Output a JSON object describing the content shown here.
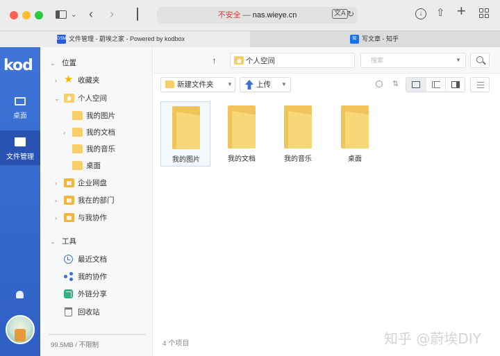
{
  "browser": {
    "address": {
      "security": "不安全",
      "separator": "—",
      "host": "nas.wieye.cn"
    },
    "tabs": [
      {
        "favicon": "DSM",
        "title": "文件管理 - 蔚埃之家 - Powered by kodbox"
      },
      {
        "favicon": "知",
        "title": "写文章 - 知乎"
      }
    ]
  },
  "rail": {
    "logo": "kod",
    "items": [
      {
        "label": "桌面",
        "icon": "monitor-icon"
      },
      {
        "label": "文件管理",
        "icon": "folder-icon"
      }
    ]
  },
  "tree": {
    "location_header": "位置",
    "items": [
      {
        "label": "收藏夹",
        "icon": "star-icon"
      },
      {
        "label": "个人空间",
        "icon": "home-folder-icon"
      },
      {
        "label": "我的图片",
        "icon": "folder-icon"
      },
      {
        "label": "我的文档",
        "icon": "folder-icon"
      },
      {
        "label": "我的音乐",
        "icon": "folder-icon"
      },
      {
        "label": "桌面",
        "icon": "folder-icon"
      },
      {
        "label": "企业网盘",
        "icon": "drive-folder-icon"
      },
      {
        "label": "我在的部门",
        "icon": "drive-folder-icon"
      },
      {
        "label": "与我协作",
        "icon": "drive-folder-icon"
      }
    ],
    "tools_header": "工具",
    "tools": [
      {
        "label": "最近文档",
        "icon": "clock-icon"
      },
      {
        "label": "我的协作",
        "icon": "collab-icon"
      },
      {
        "label": "外链分享",
        "icon": "link-share-icon"
      },
      {
        "label": "回收站",
        "icon": "recycle-bin-icon"
      }
    ],
    "quota": "99.5MB / 不限制"
  },
  "main": {
    "breadcrumb": "个人空间",
    "search_placeholder": "搜索",
    "toolbar": {
      "new_folder": "新建文件夹",
      "upload": "上传"
    },
    "files": [
      {
        "name": "我的图片"
      },
      {
        "name": "我的文档"
      },
      {
        "name": "我的音乐"
      },
      {
        "name": "桌面"
      }
    ],
    "item_count": "4 个项目",
    "watermark": "知乎 @蔚埃DIY"
  }
}
